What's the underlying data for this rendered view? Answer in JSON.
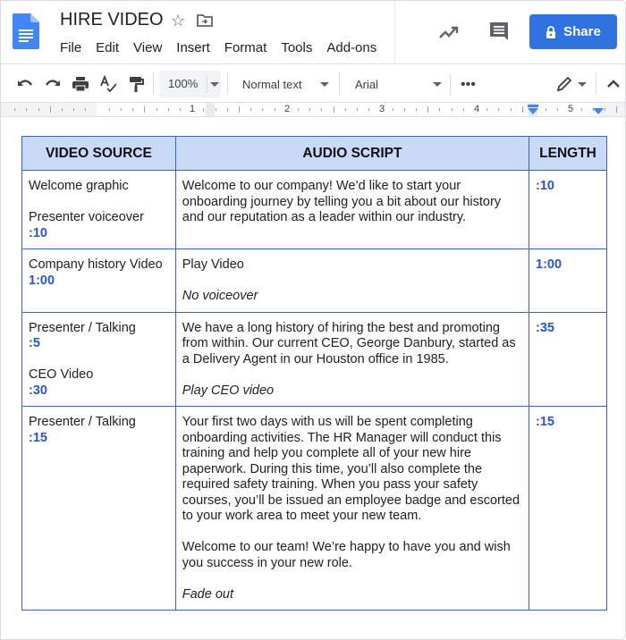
{
  "header": {
    "title": "HIRE VIDEO",
    "menu": [
      "File",
      "Edit",
      "View",
      "Insert",
      "Format",
      "Tools",
      "Add-ons"
    ],
    "share_label": "Share",
    "icons": {
      "logo": "docs-logo-icon",
      "star": "star-icon",
      "move": "move-to-folder-icon",
      "activity": "activity-trend-icon",
      "comments": "comment-icon",
      "lock": "lock-icon"
    }
  },
  "toolbar": {
    "zoom": "100%",
    "style": "Normal text",
    "font": "Arial",
    "more_label": "•••",
    "icons": [
      "undo-icon",
      "redo-icon",
      "print-icon",
      "spellcheck-icon",
      "paint-format-icon",
      "edit-mode-pencil-icon",
      "collapse-chevron-up-icon"
    ]
  },
  "ruler": {
    "numbers": [
      "1",
      "2",
      "3",
      "4",
      "5"
    ]
  },
  "table": {
    "columns": [
      "VIDEO SOURCE",
      "AUDIO SCRIPT",
      "LENGTH"
    ],
    "rows": [
      {
        "source": [
          {
            "text": "Welcome graphic",
            "type": "plain"
          },
          {
            "text": "",
            "type": "gap"
          },
          {
            "text": "Presenter voiceover",
            "type": "plain"
          },
          {
            "text": ":10",
            "type": "length"
          }
        ],
        "script": [
          {
            "text": "Welcome to our company! We’d like to start your onboarding journey by telling you a bit about our history and our reputation as a leader within our industry.",
            "type": "plain"
          }
        ],
        "length": ":10"
      },
      {
        "source": [
          {
            "text": "Company history Video",
            "type": "plain"
          },
          {
            "text": "1:00",
            "type": "length"
          }
        ],
        "script": [
          {
            "text": "Play Video",
            "type": "plain"
          },
          {
            "text": "",
            "type": "gap"
          },
          {
            "text": "No voiceover",
            "type": "italic"
          }
        ],
        "length": "1:00"
      },
      {
        "source": [
          {
            "text": "Presenter / Talking",
            "type": "plain"
          },
          {
            "text": ":5",
            "type": "length"
          },
          {
            "text": "",
            "type": "gap"
          },
          {
            "text": "CEO Video",
            "type": "plain"
          },
          {
            "text": ":30",
            "type": "length"
          }
        ],
        "script": [
          {
            "text": "We have a long history of hiring the best and promoting from within. Our current CEO, George Danbury, started as a Delivery Agent in our Houston office in 1985.",
            "type": "plain"
          },
          {
            "text": "",
            "type": "gap"
          },
          {
            "text": "Play CEO video",
            "type": "italic"
          }
        ],
        "length": ":35"
      },
      {
        "source": [
          {
            "text": "Presenter / Talking",
            "type": "plain"
          },
          {
            "text": ":15",
            "type": "length"
          }
        ],
        "script": [
          {
            "text": "Your first two days with us will be spent completing onboarding activities. The HR Manager will conduct this training and help you complete all of your new hire paperwork. During this time, you’ll also complete the required safety training. When you pass your safety courses, you’ll be issued an employee badge and escorted to your work area to meet your new team.",
            "type": "plain"
          },
          {
            "text": "",
            "type": "gap"
          },
          {
            "text": "Welcome to our team! We’re happy to have you and wish you success in your new role.",
            "type": "plain"
          },
          {
            "text": "",
            "type": "gap"
          },
          {
            "text": "Fade out",
            "type": "italic"
          }
        ],
        "length": ":15"
      }
    ]
  },
  "colors": {
    "share_button": "#2f72e0",
    "table_header_bg": "#c9daf8",
    "table_border": "#3c62c2",
    "length_text": "#2a56c6"
  }
}
